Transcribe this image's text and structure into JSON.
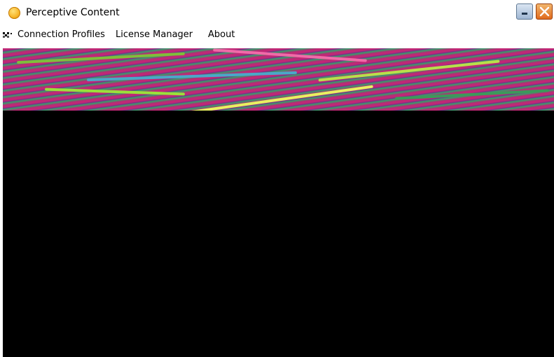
{
  "window": {
    "title": "Perceptive Content",
    "icon": "app-orb-icon",
    "controls": [
      "minimize-icon",
      "close-icon"
    ]
  },
  "menu": {
    "icon": "connection-icon",
    "items": [
      {
        "label": "Connection Profiles"
      },
      {
        "label": "License Manager"
      },
      {
        "label": "About"
      }
    ]
  },
  "colors": {
    "title_bg": "#ffffff",
    "banner_primary": "#c02876",
    "banner_secondary": "#a6e03b",
    "content_bg": "#000000",
    "close_button": "#e06a1c",
    "minimize_button": "#9fb6d3"
  }
}
